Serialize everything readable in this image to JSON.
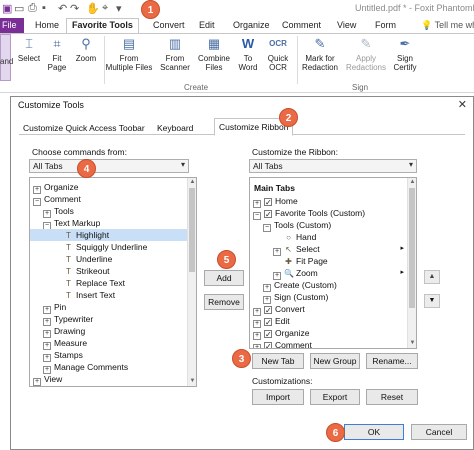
{
  "titlebar": {
    "quick_access": [
      "app-logo-icon",
      "open-icon",
      "print-icon",
      "save-icon",
      "undo-icon",
      "redo-icon",
      "hand-icon",
      "select-icon",
      "dropdown-icon"
    ],
    "document_title": "Untitled.pdf * - Foxit PhantomPDF"
  },
  "ribbon_tabs": {
    "file": "File",
    "items": [
      "Home",
      "Favorite Tools",
      "Convert",
      "Edit",
      "Organize",
      "Comment",
      "View",
      "Form"
    ],
    "active": "Favorite Tools",
    "tell_me": "Tell me wh"
  },
  "ribbon": {
    "hand_label": "and",
    "buttons": {
      "select": "Select",
      "fit_page": "Fit\nPage",
      "zoom": "Zoom",
      "from_multiple_files": "From\nMultiple Files",
      "from_scanner": "From\nScanner",
      "combine_files": "Combine\nFiles",
      "to_word": "To\nWord",
      "quick_ocr": "Quick\nOCR",
      "mark_for_redaction": "Mark for\nRedaction",
      "apply_redactions": "Apply\nRedactions",
      "sign_certify": "Sign\nCertify"
    },
    "groups": {
      "create": "Create",
      "sign": "Sign"
    }
  },
  "dialog": {
    "title": "Customize Tools",
    "close": "✕",
    "tabs": [
      "Customize Quick Access Toobar",
      "Keyboard",
      "Customize Ribbon"
    ],
    "active_tab": "Customize Ribbon",
    "left": {
      "label": "Choose commands from:",
      "combo": "All Tabs",
      "items": [
        {
          "text": "Organize",
          "depth": 0,
          "toggle": "+"
        },
        {
          "text": "Comment",
          "depth": 0,
          "toggle": "−"
        },
        {
          "text": "Tools",
          "depth": 1,
          "toggle": "+"
        },
        {
          "text": "Text Markup",
          "depth": 1,
          "toggle": "−"
        },
        {
          "text": "Highlight",
          "depth": 2,
          "icon": "T",
          "selected": true
        },
        {
          "text": "Squiggly Underline",
          "depth": 2,
          "icon": "T"
        },
        {
          "text": "Underline",
          "depth": 2,
          "icon": "T"
        },
        {
          "text": "Strikeout",
          "depth": 2,
          "icon": "T"
        },
        {
          "text": "Replace Text",
          "depth": 2,
          "icon": "T"
        },
        {
          "text": "Insert Text",
          "depth": 2,
          "icon": "T"
        },
        {
          "text": "Pin",
          "depth": 1,
          "toggle": "+"
        },
        {
          "text": "Typewriter",
          "depth": 1,
          "toggle": "+"
        },
        {
          "text": "Drawing",
          "depth": 1,
          "toggle": "+"
        },
        {
          "text": "Measure",
          "depth": 1,
          "toggle": "+"
        },
        {
          "text": "Stamps",
          "depth": 1,
          "toggle": "+"
        },
        {
          "text": "Manage Comments",
          "depth": 1,
          "toggle": "+"
        },
        {
          "text": "View",
          "depth": 0,
          "toggle": "+"
        }
      ]
    },
    "right": {
      "label": "Customize the Ribbon:",
      "combo": "All Tabs",
      "header": "Main Tabs",
      "items": [
        {
          "text": "Home",
          "depth": 0,
          "toggle": "+",
          "checked": true
        },
        {
          "text": "Favorite Tools (Custom)",
          "depth": 0,
          "toggle": "−",
          "checked": true
        },
        {
          "text": "Tools (Custom)",
          "depth": 1,
          "toggle": "−"
        },
        {
          "text": "Hand",
          "depth": 2,
          "icon": "○"
        },
        {
          "text": "Select",
          "depth": 2,
          "toggle": "+",
          "icon": "↖",
          "submenu": true
        },
        {
          "text": "Fit Page",
          "depth": 2,
          "icon": "✚"
        },
        {
          "text": "Zoom",
          "depth": 2,
          "toggle": "+",
          "icon": "🔍",
          "submenu": true
        },
        {
          "text": "Create (Custom)",
          "depth": 1,
          "toggle": "+"
        },
        {
          "text": "Sign (Custom)",
          "depth": 1,
          "toggle": "+"
        },
        {
          "text": "Convert",
          "depth": 0,
          "toggle": "+",
          "checked": true
        },
        {
          "text": "Edit",
          "depth": 0,
          "toggle": "+",
          "checked": true
        },
        {
          "text": "Organize",
          "depth": 0,
          "toggle": "+",
          "checked": true
        },
        {
          "text": "Comment",
          "depth": 0,
          "toggle": "+",
          "checked": true
        }
      ]
    },
    "add_button": "Add",
    "remove_button": "Remove",
    "new_tab_button": "New Tab",
    "new_group_button": "New Group",
    "rename_button": "Rename...",
    "customizations_label": "Customizations:",
    "import_button": "Import",
    "export_button": "Export",
    "reset_button": "Reset",
    "ok_button": "OK",
    "cancel_button": "Cancel",
    "move_up": "▲",
    "move_down": "▼"
  },
  "callouts": [
    "1",
    "2",
    "3",
    "4",
    "5",
    "6"
  ],
  "colors": {
    "file_tab": "#7a2f96",
    "callout": "#e96a45",
    "selection": "#c8dff7"
  }
}
